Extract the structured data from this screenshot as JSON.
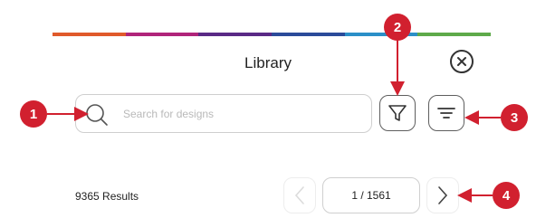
{
  "header": {
    "title": "Library",
    "accent_colors": [
      "#e05a2b",
      "#b0247a",
      "#5a2a86",
      "#2b4b9a",
      "#2b8fc8",
      "#5eaa4a"
    ]
  },
  "close": {
    "icon": "close-icon"
  },
  "search": {
    "placeholder": "Search for designs",
    "value": "",
    "icon": "search-icon"
  },
  "toolbar": {
    "filter_icon": "filter-icon",
    "sort_icon": "sort-icon"
  },
  "results": {
    "count_label": "9365 Results"
  },
  "pagination": {
    "page_label": "1 / 1561",
    "prev_icon": "chevron-left-icon",
    "next_icon": "chevron-right-icon"
  },
  "callouts": {
    "color": "#d1202f",
    "labels": [
      "1",
      "2",
      "3",
      "4"
    ]
  }
}
